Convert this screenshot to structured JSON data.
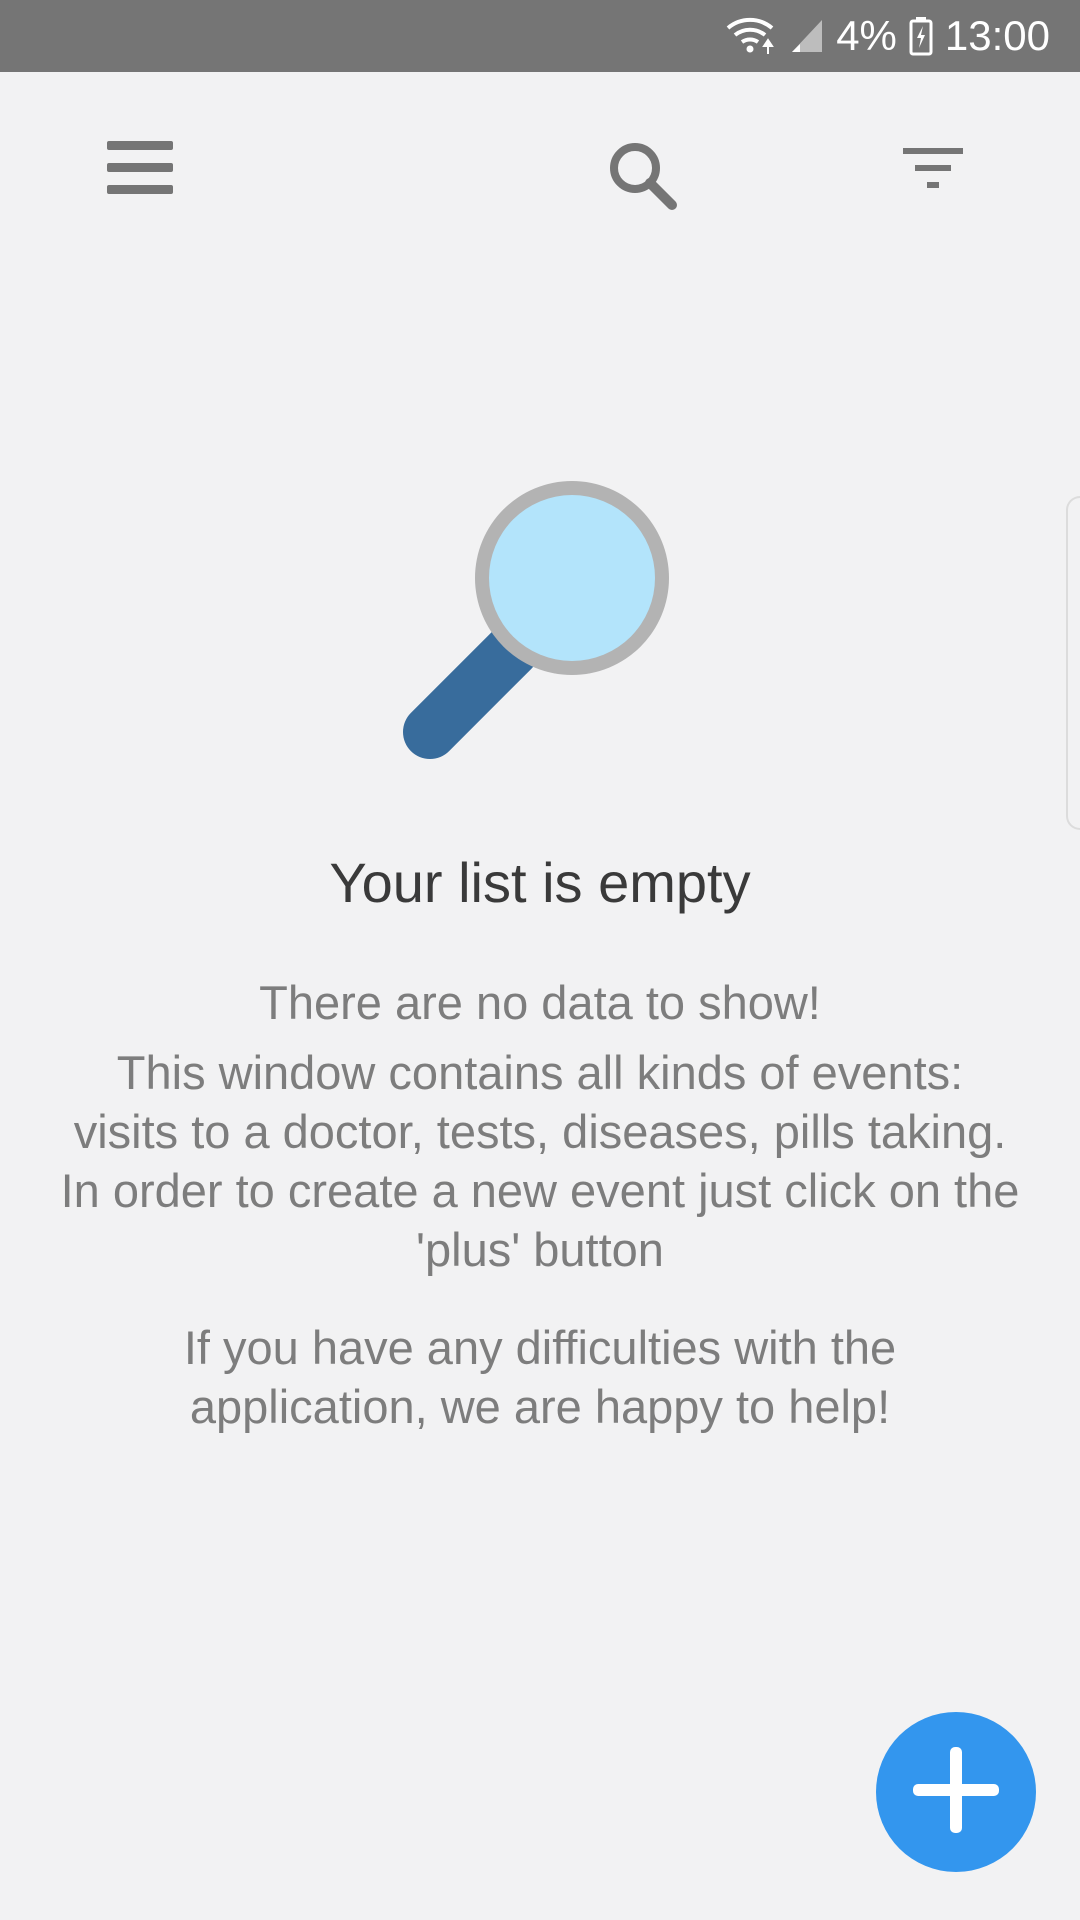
{
  "status_bar": {
    "battery_percent": "4%",
    "time": "13:00",
    "icons": [
      "wifi-icon",
      "signal-icon",
      "battery-charging-icon"
    ]
  },
  "toolbar": {
    "menu_icon": "hamburger-menu-icon",
    "search_icon": "search-icon",
    "filter_icon": "filter-icon"
  },
  "empty_state": {
    "illustration": "magnifying-glass-icon",
    "title": "Your list is empty",
    "message_1": "There are no data to show!",
    "message_2": "This window contains all kinds of events: visits to a doctor, tests, diseases, pills taking. In order to create a new event just click on the 'plus' button",
    "message_3": "If you have any difficulties with the application, we are happy to help!"
  },
  "fab": {
    "icon": "plus-icon",
    "color": "#3396ee"
  },
  "colors": {
    "status_bar": "#757575",
    "background": "#f2f2f3",
    "icon_gray": "#757575",
    "lens_fill": "#b3e4fb",
    "lens_ring": "#b3b3b3",
    "handle": "#386c9c"
  }
}
